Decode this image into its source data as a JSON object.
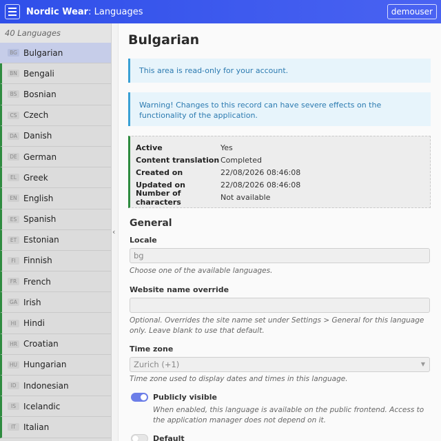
{
  "header": {
    "brand": "Nordic Wear",
    "section": ": Languages",
    "user": "demouser"
  },
  "sidebar": {
    "count_label": "40 Languages",
    "items": [
      {
        "code": "BG",
        "name": "Bulgarian"
      },
      {
        "code": "BN",
        "name": "Bengali"
      },
      {
        "code": "BS",
        "name": "Bosnian"
      },
      {
        "code": "CS",
        "name": "Czech"
      },
      {
        "code": "DA",
        "name": "Danish"
      },
      {
        "code": "DE",
        "name": "German"
      },
      {
        "code": "EL",
        "name": "Greek"
      },
      {
        "code": "EN",
        "name": "English"
      },
      {
        "code": "ES",
        "name": "Spanish"
      },
      {
        "code": "ET",
        "name": "Estonian"
      },
      {
        "code": "FI",
        "name": "Finnish"
      },
      {
        "code": "FR",
        "name": "French"
      },
      {
        "code": "GA",
        "name": "Irish"
      },
      {
        "code": "HI",
        "name": "Hindi"
      },
      {
        "code": "HR",
        "name": "Croatian"
      },
      {
        "code": "HU",
        "name": "Hungarian"
      },
      {
        "code": "ID",
        "name": "Indonesian"
      },
      {
        "code": "IS",
        "name": "Icelandic"
      },
      {
        "code": "IT",
        "name": "Italian"
      }
    ],
    "active_index": 0
  },
  "main": {
    "title": "Bulgarian",
    "notice_readonly": "This area is read-only for your account.",
    "notice_warning": "Warning! Changes to this record can have severe effects on the functionality of the application.",
    "meta": [
      {
        "key": "Active",
        "value": "Yes"
      },
      {
        "key": "Content translation",
        "value": "Completed"
      },
      {
        "key": "Created on",
        "value": "22/08/2026 08:46:08"
      },
      {
        "key": "Updated on",
        "value": "22/08/2026 08:46:08"
      },
      {
        "key": "Number of characters",
        "value": "Not available"
      }
    ],
    "section_general": "General",
    "locale": {
      "label": "Locale",
      "value": "bg",
      "help": "Choose one of the available languages."
    },
    "site_name": {
      "label": "Website name override",
      "value": "",
      "help": "Optional. Overrides the site name set under Settings > General for this language only. Leave blank to use that default."
    },
    "timezone": {
      "label": "Time zone",
      "value": "Zurich (+1)",
      "help": "Time zone used to display dates and times in this language."
    },
    "public_visible": {
      "label": "Publicly visible",
      "on": true,
      "help": "When enabled, this language is available on the public frontend. Access to the application manager does not depend on it."
    },
    "default": {
      "label": "Default",
      "on": false
    }
  },
  "colors": {
    "header": "#3552ee",
    "active_item": "#c6cde9",
    "status_bar": "#2e8b3f",
    "notice": "#3aa0d4",
    "toggle_on": "#6c7ee8"
  }
}
